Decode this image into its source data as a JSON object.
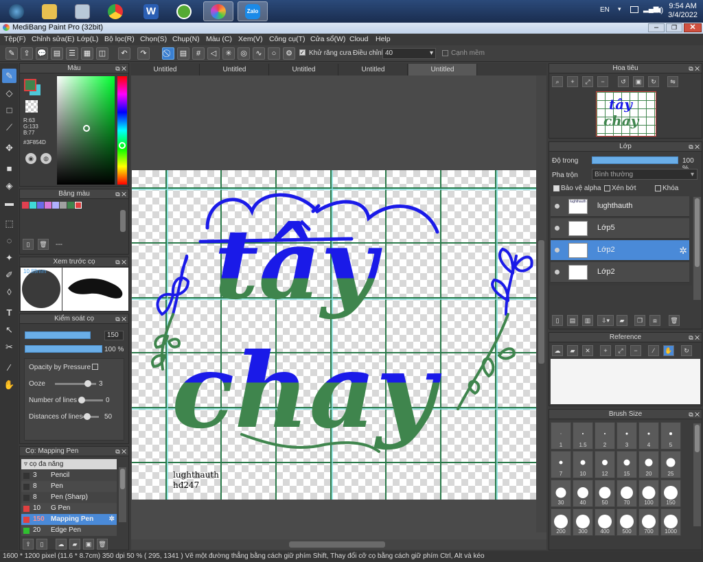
{
  "taskbar": {
    "apps": [
      "start-orb",
      "file-explorer",
      "calculator",
      "chrome",
      "word",
      "snagit",
      "medibang",
      "zalo"
    ],
    "lang": "EN",
    "time": "9:54 AM",
    "date": "3/4/2022",
    "zalo_label": "Zalo",
    "word_label": "W"
  },
  "window": {
    "title": "MediBang Paint Pro (32bit)"
  },
  "menu": [
    "Tệp(F)",
    "Chỉnh sửa(E)",
    "Lớp(L)",
    "Bộ lọc(R)",
    "Chọn(S)",
    "Chụp(N)",
    "Màu (C)",
    "Xem(V)",
    "Công cụ(T)",
    "Cửa sổ(W)",
    "Cloud",
    "Help"
  ],
  "toolbar": {
    "antialias_label": "Khử răng cưa",
    "adjust_label": "Điều chỉnh",
    "adjust_value": "40",
    "smooth_label": "Cạnh mềm"
  },
  "tabs": [
    "Untitled",
    "Untitled",
    "Untitled",
    "Untitled",
    "Untitled"
  ],
  "color_panel": {
    "title": "Màu",
    "r": "R:63",
    "g": "G:133",
    "b": "B:77",
    "hex": "#3F854D",
    "primary": "#3F854D",
    "secondary": "#4ec8d8"
  },
  "palette_panel": {
    "title": "Bảng màu",
    "swatches": [
      "#e04050",
      "#40d8d8",
      "#6a6ae8",
      "#d878d8",
      "#b0b0ff",
      "#a0a0a0",
      "#3F854D",
      "#e04040"
    ],
    "dash": "---"
  },
  "preview_panel": {
    "title": "Xem trước cọ",
    "size": "10.89mm"
  },
  "control_panel": {
    "title": "Kiểm soát cọ",
    "size_value": "150",
    "opacity_value": "100 %",
    "opacity_pressure": "Opacity by Pressure",
    "ooze_label": "Ooze",
    "ooze_value": "3",
    "lines_label": "Number of lines",
    "lines_value": "0",
    "dist_label": "Distances of lines",
    "dist_value": "50",
    "size_fraction": 0.85,
    "opacity_fraction": 1.0,
    "ooze_fraction": 0.8,
    "lines_fraction": 0.1,
    "dist_fraction": 0.3
  },
  "brush_panel": {
    "title": "Cọ: Mapping Pen",
    "group": "cọ đa năng",
    "items": [
      {
        "num": "3",
        "name": "Pencil",
        "color": "#333"
      },
      {
        "num": "8",
        "name": "Pen",
        "color": "#333"
      },
      {
        "num": "8",
        "name": "Pen (Sharp)",
        "color": "#333"
      },
      {
        "num": "10",
        "name": "G Pen",
        "color": "#e04040"
      },
      {
        "num": "150",
        "name": "Mapping Pen",
        "color": "#e04040"
      },
      {
        "num": "20",
        "name": "Edge Pen",
        "color": "#30c030"
      }
    ]
  },
  "canvas_art": {
    "word1": "tây",
    "word2": "chay",
    "signature1": "lughthauth",
    "signature2": "hđ247"
  },
  "navigator_panel": {
    "title": "Hoa tiêu"
  },
  "layer_panel": {
    "title": "Lớp",
    "opacity_label": "Độ trong",
    "opacity_value": "100 %",
    "blend_label": "Pha trộn",
    "blend_value": "Bình thường",
    "protect_alpha": "Bảo vệ alpha",
    "clip": "Xén bớt",
    "lock": "Khóa",
    "layers": [
      "lughthauth",
      "Lớp5",
      "Lớp2",
      "Lớp2"
    ]
  },
  "reference_panel": {
    "title": "Reference"
  },
  "brush_size_panel": {
    "title": "Brush Size",
    "sizes": [
      "1",
      "1.5",
      "2",
      "3",
      "4",
      "5",
      "7",
      "10",
      "12",
      "15",
      "20",
      "25",
      "30",
      "40",
      "50",
      "70",
      "100",
      "150",
      "200",
      "300",
      "400",
      "500",
      "700",
      "1000"
    ]
  },
  "status": {
    "text": "1600 * 1200 pixel   (11.6 * 8.7cm)   350 dpi   50 %   ( 295, 1341 )   Vẽ một đường thẳng bằng cách giữ phím Shift, Thay đổi cỡ cọ bằng cách giữ phím Ctrl, Alt và kéo"
  }
}
